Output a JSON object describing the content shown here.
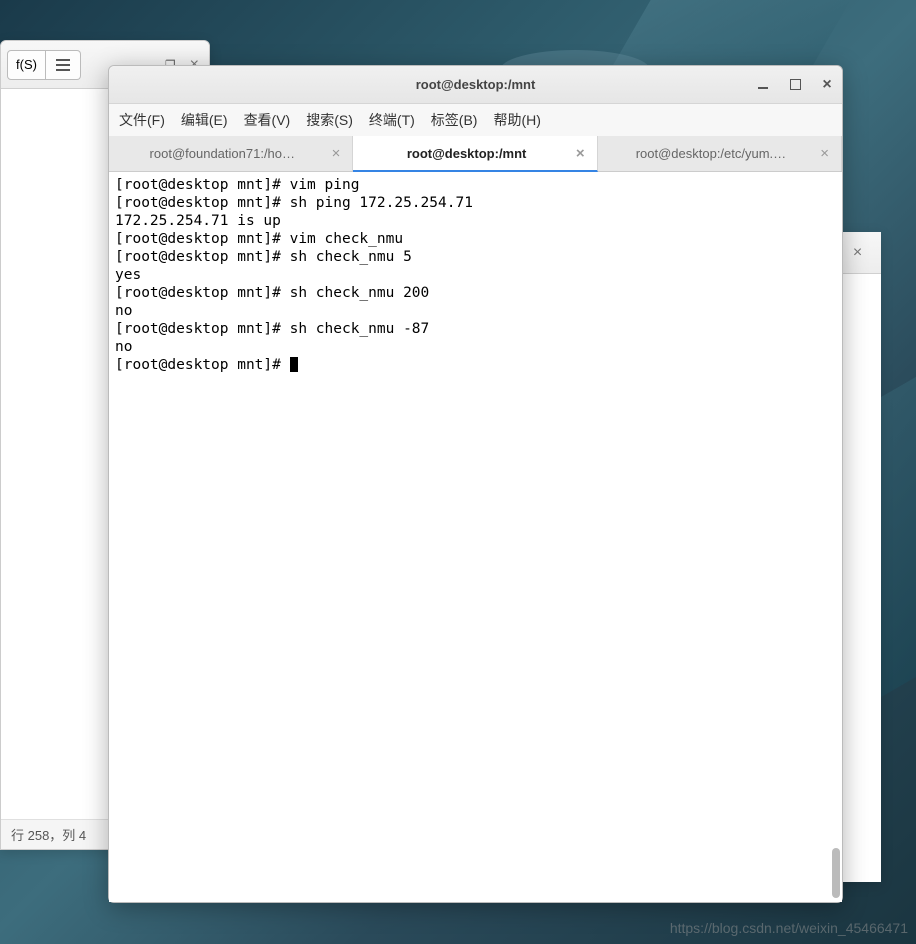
{
  "bg_editor": {
    "open_btn": "f(S)",
    "status": "行 258，列 4"
  },
  "terminal": {
    "title": "root@desktop:/mnt",
    "menu": {
      "file": "文件(F)",
      "edit": "编辑(E)",
      "view": "查看(V)",
      "search": "搜索(S)",
      "terminal": "终端(T)",
      "tabs": "标签(B)",
      "help": "帮助(H)"
    },
    "tabs": [
      {
        "label": "root@foundation71:/ho…",
        "active": false
      },
      {
        "label": "root@desktop:/mnt",
        "active": true
      },
      {
        "label": "root@desktop:/etc/yum.…",
        "active": false
      }
    ],
    "lines": [
      "[root@desktop mnt]# vim ping",
      "[root@desktop mnt]# sh ping 172.25.254.71",
      "172.25.254.71 is up",
      "[root@desktop mnt]# vim check_nmu",
      "[root@desktop mnt]# sh check_nmu 5",
      "yes",
      "[root@desktop mnt]# sh check_nmu 200",
      "no",
      "[root@desktop mnt]# sh check_nmu -87",
      "no",
      "[root@desktop mnt]# "
    ]
  },
  "watermark": "https://blog.csdn.net/weixin_45466471"
}
